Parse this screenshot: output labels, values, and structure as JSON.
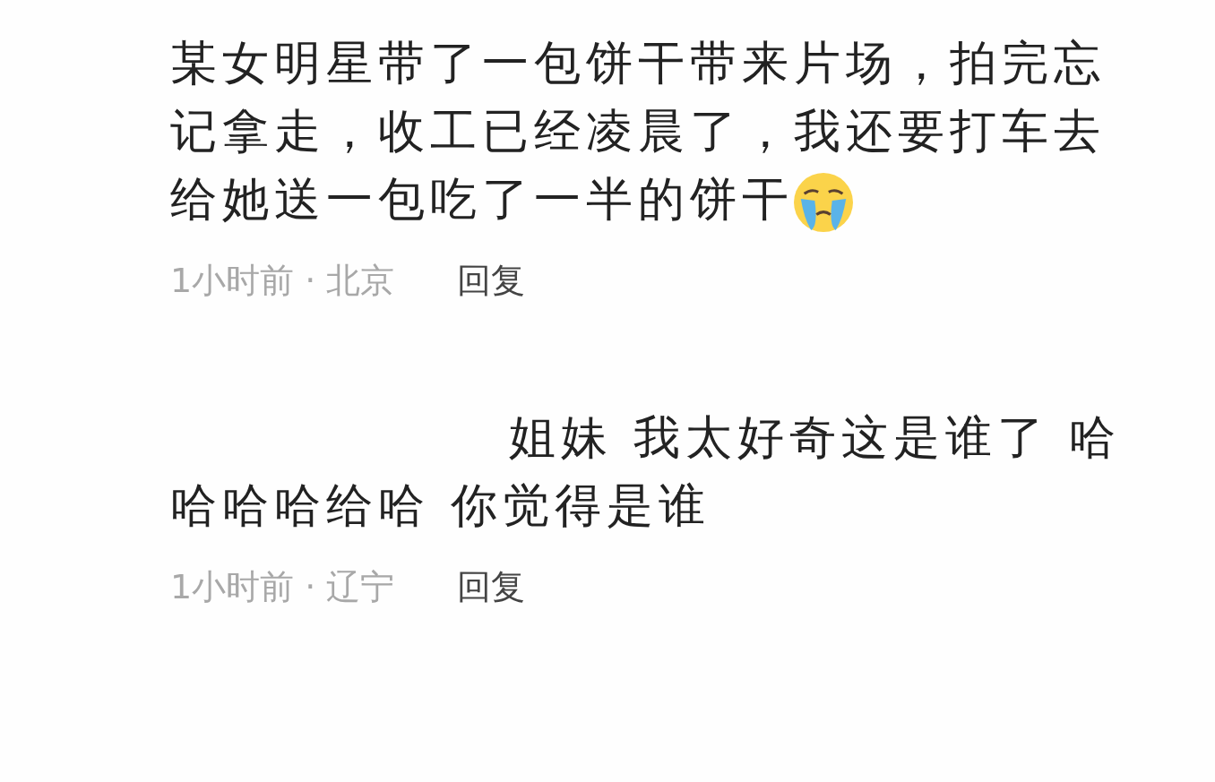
{
  "comments": [
    {
      "text": "某女明星带了一包饼干带来片场，拍完忘记拿走，收工已经凌晨了，我还要打车去给她送一包吃了一半的饼干",
      "crying_emoji": true,
      "indented": false,
      "meta": "1小时前 · 北京",
      "reply": "回复"
    },
    {
      "text": "姐妹 我太好奇这是谁了 哈哈哈哈给哈 你觉得是谁",
      "indented": true,
      "meta": "1小时前 · 辽宁",
      "reply": "回复"
    }
  ]
}
